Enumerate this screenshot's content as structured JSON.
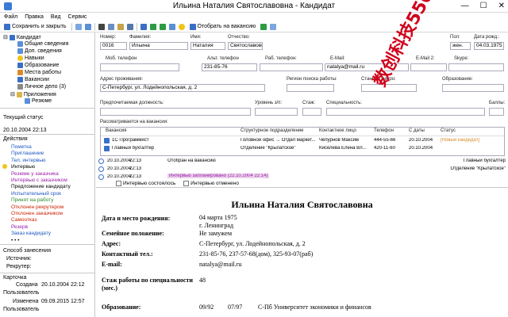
{
  "window": {
    "title": "Ильина Наталия Святославовна - Кандидат",
    "minimize": "—",
    "maximize": "☐",
    "close": "✕"
  },
  "menu": [
    "Файл",
    "Правка",
    "Вид",
    "Сервис"
  ],
  "toolbar": {
    "save_close": "Сохранить и закрыть",
    "send_vacancy": "Отобрать на вакансию"
  },
  "tree": {
    "root": "Кандидат",
    "items": [
      "Общие сведения",
      "Доп. сведения",
      "Навыки",
      "Образование",
      "Места работы",
      "Вакансии",
      "Личное дело  (3)",
      "Приложения",
      "Резюме"
    ]
  },
  "status": {
    "label": "Текущий статус",
    "value": "20.10.2004 22:13"
  },
  "actions": {
    "label": "Действия",
    "items": [
      "Пометка",
      "Приглашение",
      "Тел. интервью",
      "Интервью",
      "Резюме у заказчика",
      "Интервью с заказчиком",
      "Предложение кандидату",
      "Испытательный срок",
      "Принят на работу",
      "Отклонен рекрутером",
      "Отклонен заказчиком",
      "Самоотказ",
      "Резерв",
      "Заказ кандидату",
      "• • •"
    ],
    "colors": [
      "#1a55c0",
      "#1a55c0",
      "#1a55c0",
      "#000000",
      "#9b1fa8",
      "#9b1fa8",
      "#000000",
      "#1a55c0",
      "#2a8a2a",
      "#cc2200",
      "#cc2200",
      "#cc2200",
      "#9b1fa8",
      "#1a55c0",
      "#000000"
    ]
  },
  "source": {
    "label": "Способ занесения",
    "source_label": "Источник:",
    "recruiter_label": "Рекрутер:"
  },
  "card": {
    "label": "Карточка",
    "created_label": "Создана",
    "created": "20.10.2004 22:12",
    "user_label": "Пользователь",
    "changed_label": "Изменена",
    "changed": "09.09.2015 12:57",
    "user2_label": "Пользователь"
  },
  "form": {
    "num_label": "Номер:",
    "num": "0016",
    "last_label": "Фамилия:",
    "last": "Ильина",
    "first_label": "Имя:",
    "first": "Наталия",
    "middle_label": "Отчество:",
    "middle": "Святославовна",
    "sex_label": "Пол:",
    "sex": "жен.",
    "dob_label": "Дата рожд.:",
    "dob": "04.03.1975",
    "mobile_label": "Моб. телефон",
    "alt_label": "Альт. телефон",
    "alt": "231-85-76",
    "work_label": "Раб. телефон:",
    "email_label": "E-Mail:",
    "email": "natalya@mail.ru",
    "email2_label": "E-Mail 2:",
    "skype_label": "Skype:",
    "addr_label": "Адрес проживания:",
    "addr": "С-Петербург, ул. Лодейнопольская, д. 2",
    "region_label": "Регион поиска работы:",
    "metro_label": "Станция метро:",
    "edu_label": "Образование:",
    "position_label": "Предпочитаемая должность:",
    "level_label": "Уровень з/п:",
    "exp_label": "Стаж:",
    "spec_label": "Специальность:",
    "score_label": "Баллы:"
  },
  "vacancies": {
    "label": "Рассматривается на вакансии:",
    "headers": [
      "Вакансия",
      "Структурное подразделение",
      "Контактное лицо",
      "Телефон",
      "С даты",
      "Статус"
    ],
    "rows": [
      [
        "1С Программист",
        "Головной офис → Отдел маркет...",
        "Чепурнов Максим",
        "444-55-66",
        "20.10.2004",
        "[Новый кандидат]"
      ],
      [
        "Главный бухгалтер",
        "Отделение \"Крылатское\"",
        "Киселева Елена Вл...",
        "420-11-60",
        "20.10.2004",
        ""
      ]
    ]
  },
  "history": [
    {
      "date": "20.10.2004",
      "time": "22:13",
      "text": "Отобран на вакансию",
      "right": "Главный бухгалтер"
    },
    {
      "date": "20.10.2004",
      "time": "22:13",
      "text": "",
      "right": "Отделение \"Крылатское\""
    },
    {
      "date": "20.10.2004",
      "time": "22:13",
      "text": "Интервью запланировано  (22.10.2004  22:14)",
      "right": ""
    }
  ],
  "checks": {
    "done": "Интервью состоялось",
    "cancel": "Интервью отменено"
  },
  "resume": {
    "name": "Ильина Наталия Святославовна",
    "dob_label": "Дата и место рождения:",
    "dob": "04 марта 1975",
    "pob": "г. Ленинград",
    "family_label": "Семейное положение:",
    "family": "Не замужем",
    "addr_label": "Адрес:",
    "addr": "С-Петербург, ул. Лодейнопольская, д. 2",
    "tel_label": "Контактный тел.:",
    "tel": "231-85-76, 237-57-68(дом), 325-93-07(раб)",
    "email_label": "E-mail:",
    "email": "natalya@mail.ru",
    "exp_label": "Стаж работы по специальности (мес.)",
    "exp": "48",
    "edu_label": "Образование:",
    "edu_from": "09/92",
    "edu_to": "07/97",
    "edu": "С-Пб Университет экономики и финансов"
  },
  "watermark": "数创科技5566"
}
